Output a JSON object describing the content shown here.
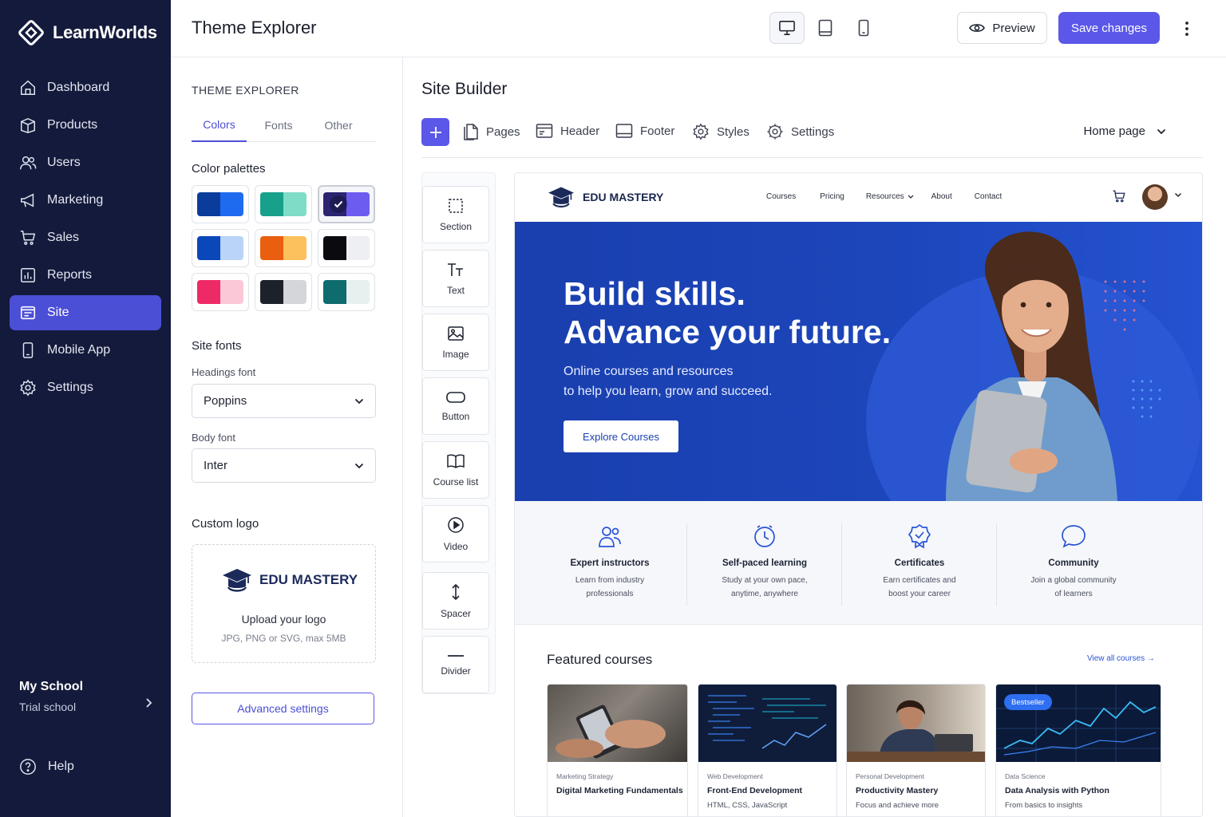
{
  "app": {
    "brand": "LearnWorlds",
    "page_title": "Theme Explorer"
  },
  "nav": {
    "items": [
      {
        "label": "Dashboard",
        "icon": "home-icon"
      },
      {
        "label": "Products",
        "icon": "box-icon"
      },
      {
        "label": "Users",
        "icon": "users-icon"
      },
      {
        "label": "Marketing",
        "icon": "megaphone-icon"
      },
      {
        "label": "Sales",
        "icon": "cart-icon"
      },
      {
        "label": "Reports",
        "icon": "chart-icon"
      },
      {
        "label": "Site",
        "icon": "browser-icon",
        "active": true
      },
      {
        "label": "Mobile App",
        "icon": "phone-icon"
      },
      {
        "label": "Settings",
        "icon": "gear-icon"
      }
    ],
    "school_name": "My School",
    "school_plan": "Trial school",
    "help": "Help"
  },
  "topbar": {
    "preview": "Preview",
    "save": "Save changes",
    "device_active": "desktop"
  },
  "theme": {
    "title": "THEME EXPLORER",
    "tabs": [
      "Colors",
      "Fonts",
      "Other"
    ],
    "active_tab": "Colors",
    "palettes_label": "Color palettes",
    "palettes": [
      [
        "#0a3c9c",
        "#1e6bef"
      ],
      [
        "#17a08a",
        "#7fdcc6"
      ],
      [
        "#2b2470",
        "#6d5cf0"
      ],
      [
        "#0a47b8",
        "#b9d4f7"
      ],
      [
        "#ea5e0f",
        "#fcc15c"
      ],
      [
        "#0b0b0f",
        "#eeeff2"
      ],
      [
        "#ee2a66",
        "#fbc8d8"
      ],
      [
        "#1d2129",
        "#d5d6da"
      ],
      [
        "#0e6b6e",
        "#e7f0ef"
      ]
    ],
    "selected_palette": 2,
    "fonts_label": "Site fonts",
    "headings_label": "Headings font",
    "headings_value": "Poppins",
    "body_label": "Body font",
    "body_value": "Inter",
    "logo_label": "Custom logo",
    "logo_brand": "EDU MASTERY",
    "upload_title": "Upload your logo",
    "upload_hint": "JPG, PNG or SVG, max 5MB",
    "advanced": "Advanced settings"
  },
  "builder": {
    "title": "Site Builder",
    "toolbar": [
      "Pages",
      "Header",
      "Footer",
      "Styles",
      "Settings"
    ],
    "page_select": "Home page",
    "blocks": [
      "Section",
      "Text",
      "Image",
      "Button",
      "Course list",
      "Video",
      "Spacer",
      "Divider"
    ]
  },
  "site": {
    "brand": "EDU MASTERY",
    "menu": [
      "Courses",
      "Pricing",
      "Resources",
      "About",
      "Contact"
    ],
    "hero_line1": "Build skills.",
    "hero_line2": "Advance your future.",
    "hero_sub1": "Online courses and resources",
    "hero_sub2": "to help you learn, grow and succeed.",
    "hero_cta": "Explore Courses",
    "features": [
      {
        "title": "Expert instructors",
        "desc1": "Learn from industry",
        "desc2": "professionals"
      },
      {
        "title": "Self-paced learning",
        "desc1": "Study at your own pace,",
        "desc2": "anytime, anywhere"
      },
      {
        "title": "Certificates",
        "desc1": "Earn certificates and",
        "desc2": "boost your career"
      },
      {
        "title": "Community",
        "desc1": "Join a global community",
        "desc2": "of learners"
      }
    ],
    "featured_title": "Featured courses",
    "view_all": "View all courses →",
    "courses": [
      {
        "category": "Marketing Strategy",
        "title": "Digital Marketing Fundamentals",
        "sub": ""
      },
      {
        "category": "Web Development",
        "title": "Front-End Development",
        "sub": "HTML, CSS, JavaScript"
      },
      {
        "category": "Personal Development",
        "title": "Productivity Mastery",
        "sub": "Focus and achieve more"
      },
      {
        "category": "Data Science",
        "title": "Data Analysis with Python",
        "sub": "From basics to insights",
        "badge": "Bestseller"
      }
    ]
  },
  "colors": {
    "nav_bg": "#141a3b",
    "accent": "#5b57e8",
    "hero_blue": "#1c46bb"
  }
}
